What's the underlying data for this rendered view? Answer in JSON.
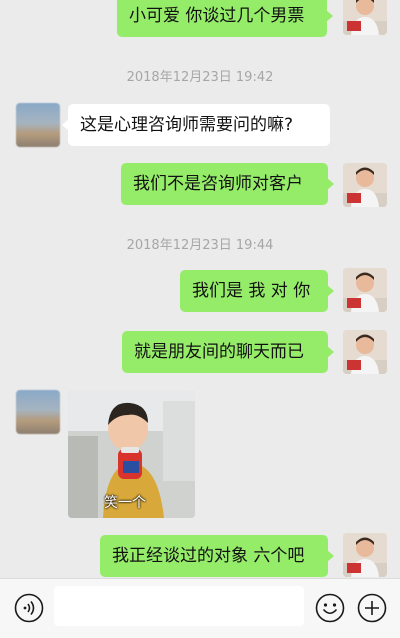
{
  "chat": {
    "messages": [
      {
        "text": "小可爱 你谈过几个男票"
      },
      {
        "text": "这是心理咨询师需要问的嘛?"
      },
      {
        "text": "我们不是咨询师对客户"
      },
      {
        "text": "我们是 我 对 你"
      },
      {
        "text": "就是朋友间的聊天而已"
      },
      {
        "text": "我正经谈过的对象 六个吧"
      }
    ],
    "timestamps": [
      "2018年12月23日 19:42",
      "2018年12月23日 19:44"
    ],
    "sticker": {
      "caption": "笑一个"
    }
  },
  "input_bar": {
    "voice_icon": "voice-icon",
    "emoji_icon": "emoji-icon",
    "add_icon": "plus-icon",
    "text_value": ""
  },
  "colors": {
    "background": "#ebebeb",
    "sent_bubble": "#95ec69",
    "received_bubble": "#ffffff"
  }
}
